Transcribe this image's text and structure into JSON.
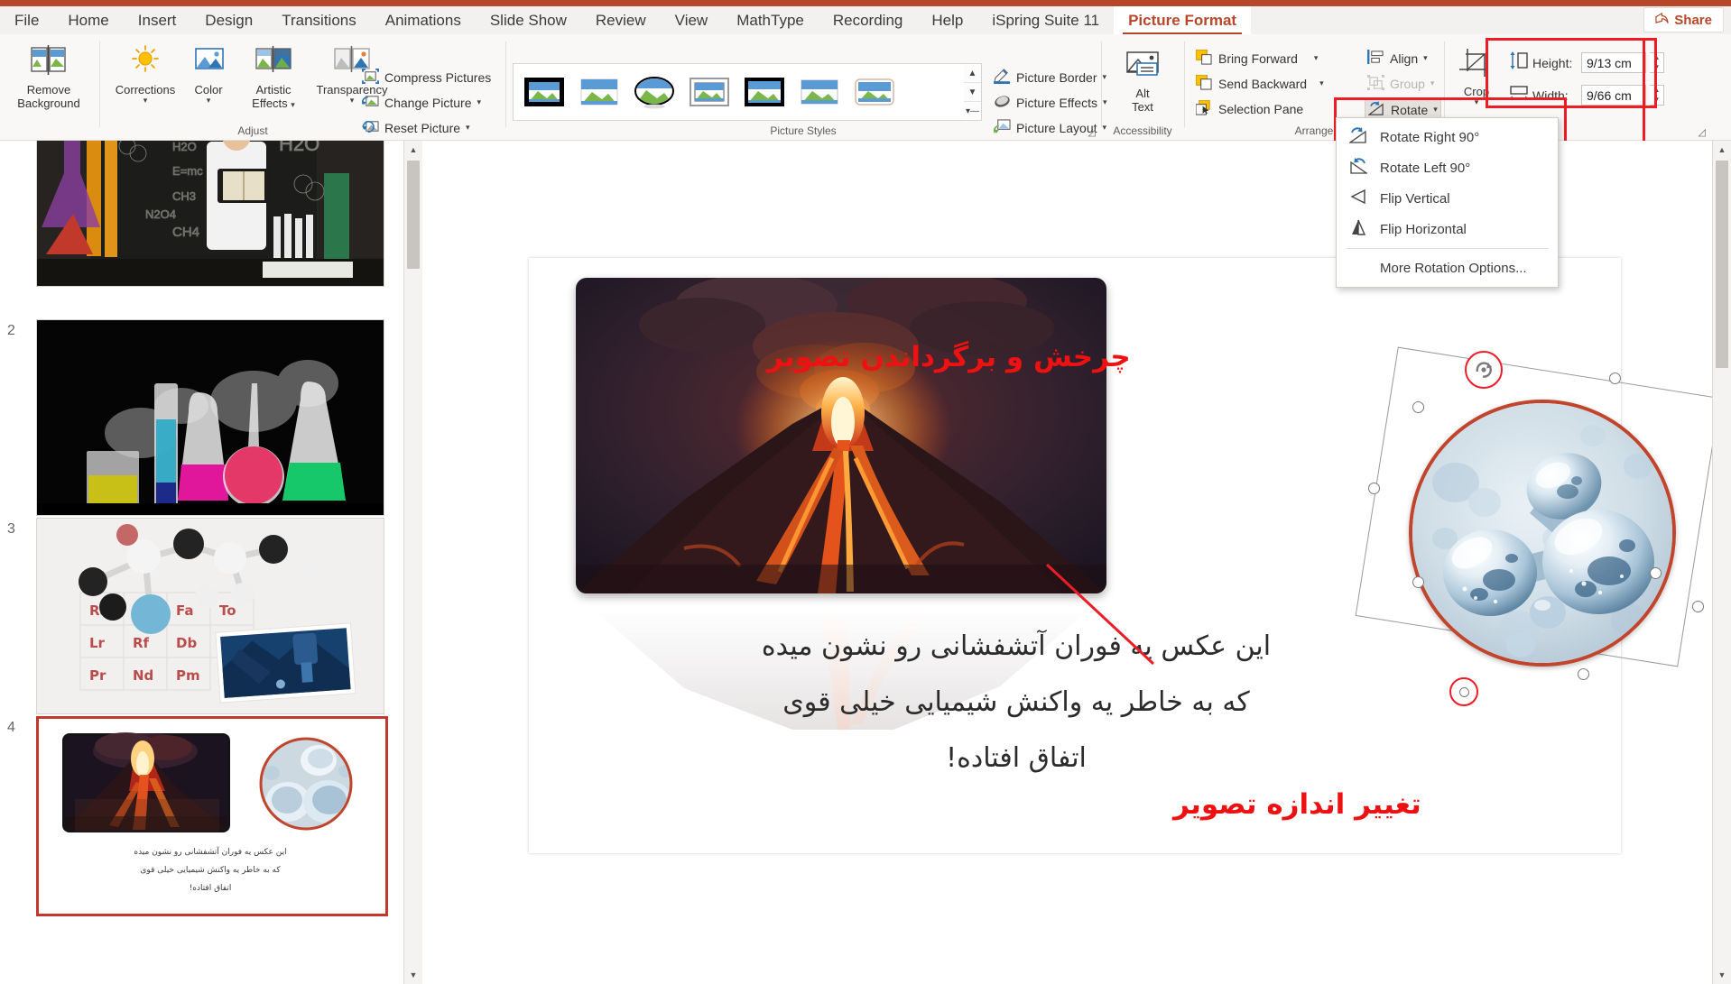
{
  "app": {
    "share_label": "Share",
    "accent": "#b7472a",
    "annotation_color": "#ee1111"
  },
  "tabs": [
    {
      "label": "File",
      "active": false
    },
    {
      "label": "Home",
      "active": false
    },
    {
      "label": "Insert",
      "active": false
    },
    {
      "label": "Design",
      "active": false
    },
    {
      "label": "Transitions",
      "active": false
    },
    {
      "label": "Animations",
      "active": false
    },
    {
      "label": "Slide Show",
      "active": false
    },
    {
      "label": "Review",
      "active": false
    },
    {
      "label": "View",
      "active": false
    },
    {
      "label": "MathType",
      "active": false
    },
    {
      "label": "Recording",
      "active": false
    },
    {
      "label": "Help",
      "active": false
    },
    {
      "label": "iSpring Suite 11",
      "active": false
    },
    {
      "label": "Picture Format",
      "active": true
    }
  ],
  "ribbon": {
    "groups": [
      {
        "name": "Adjust",
        "label": "Adjust"
      },
      {
        "name": "Picture Styles",
        "label": "Picture Styles"
      },
      {
        "name": "Accessibility",
        "label": "Accessibility"
      },
      {
        "name": "Arrange",
        "label": "Arrange"
      },
      {
        "name": "Size",
        "label": ""
      }
    ],
    "adjust": {
      "remove_background": "Remove\nBackground",
      "remove_background_l1": "Remove",
      "remove_background_l2": "Background",
      "corrections": "Corrections",
      "color": "Color",
      "artistic_effects_l1": "Artistic",
      "artistic_effects_l2": "Effects",
      "transparency": "Transparency",
      "compress_pictures": "Compress Pictures",
      "change_picture": "Change Picture",
      "reset_picture": "Reset Picture"
    },
    "picture_styles": {
      "border": "Picture Border",
      "effects": "Picture Effects",
      "layout": "Picture Layout",
      "style_count": 7
    },
    "accessibility": {
      "alt_text_l1": "Alt",
      "alt_text_l2": "Text"
    },
    "arrange": {
      "bring_forward": "Bring Forward",
      "send_backward": "Send Backward",
      "selection_pane": "Selection Pane",
      "align": "Align",
      "group": "Group",
      "rotate": "Rotate"
    },
    "size": {
      "crop": "Crop",
      "height_label": "Height:",
      "height_value": "9/13 cm",
      "width_label": "Width:",
      "width_value": "9/66 cm"
    }
  },
  "rotate_menu": {
    "items": [
      {
        "label": "Rotate Right 90°",
        "icon": "rotate-right-icon",
        "mnemonic": "R"
      },
      {
        "label": "Rotate Left 90°",
        "icon": "rotate-left-icon",
        "mnemonic": "L"
      },
      {
        "label": "Flip Vertical",
        "icon": "flip-vertical-icon",
        "mnemonic": "V"
      },
      {
        "label": "Flip Horizontal",
        "icon": "flip-horizontal-icon",
        "mnemonic": "H"
      }
    ],
    "more": "More Rotation Options..."
  },
  "thumbnails": [
    {
      "number": "",
      "selected": false,
      "alt": "chemistry student reading at blackboard"
    },
    {
      "number": "2",
      "selected": false,
      "alt": "colorful laboratory flasks with smoke"
    },
    {
      "number": "3",
      "selected": false,
      "alt": "molecular model on periodic table with microscope inset"
    },
    {
      "number": "4",
      "selected": true,
      "alt": "volcano eruption and water molecule slide"
    }
  ],
  "slide": {
    "body_lines": [
      "این عکس یه فوران آتشفشانی رو نشون میده",
      "که به خاطر یه واکنش شیمیایی خیلی قوی",
      "اتفاق افتاده!"
    ],
    "annotation_top": "چرخش و برگرداندن تصویر",
    "annotation_bottom": "تغییر اندازه تصویر"
  }
}
